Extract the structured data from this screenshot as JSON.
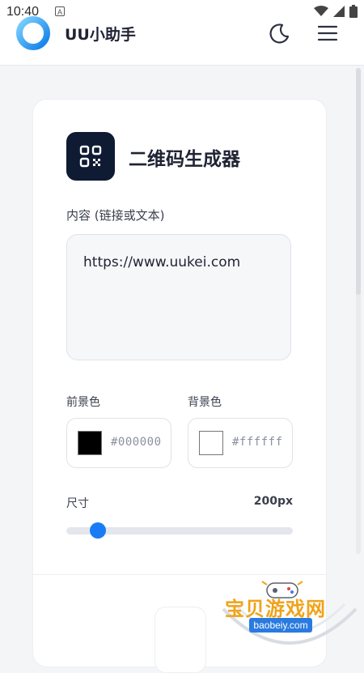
{
  "status_bar": {
    "time": "10:40",
    "badge": "A"
  },
  "header": {
    "app_title": "UU小助手",
    "logo_icon": "ring-logo-icon",
    "theme_icon": "moon-icon",
    "menu_icon": "hamburger-menu-icon"
  },
  "tool": {
    "icon": "qr-code-icon",
    "title": "二维码生成器"
  },
  "content": {
    "label": "内容 (链接或文本)",
    "value": "https://www.uukei.com"
  },
  "foreground": {
    "label": "前景色",
    "hex": "#000000",
    "color": "#000000"
  },
  "background": {
    "label": "背景色",
    "hex": "#ffffff",
    "color": "#ffffff"
  },
  "size": {
    "label": "尺寸",
    "value_text": "200px",
    "slider_fraction": 0.14
  },
  "watermark": {
    "title": "宝贝游戏网",
    "url": "baobeiy.com"
  },
  "colors": {
    "accent": "#1a7cf5",
    "icon_bg": "#0f1a33",
    "watermark_orange": "#f0a31a"
  }
}
